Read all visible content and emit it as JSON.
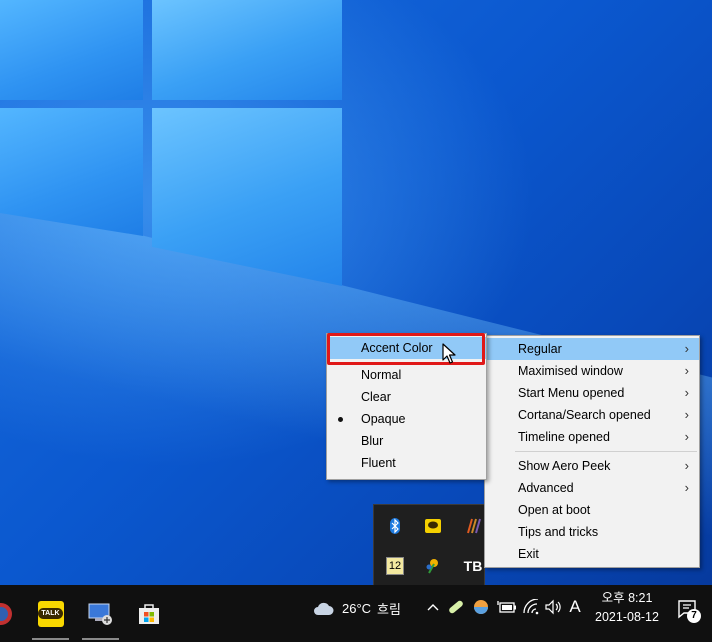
{
  "accent_menu": {
    "header": "Accent Color",
    "items": [
      "Normal",
      "Clear",
      "Opaque",
      "Blur",
      "Fluent"
    ],
    "selected": "Opaque"
  },
  "main_menu": {
    "items": [
      "Regular",
      "Maximised window",
      "Start Menu opened",
      "Cortana/Search opened",
      "Timeline opened"
    ],
    "items2": [
      "Show Aero Peek",
      "Advanced",
      "Open at boot",
      "Tips and tricks",
      "Exit"
    ]
  },
  "flyout": {
    "number_icon": "12",
    "tb_icon": "TB"
  },
  "taskbar": {
    "kakao_label": "TALK",
    "weather_temp": "26°C",
    "weather_cond": "흐림",
    "ime": "A",
    "time": "오후 8:21",
    "date": "2021-08-12",
    "notif_count": "7"
  },
  "colors": {
    "highlight": "#91c9f7",
    "annotation": "#e01818",
    "taskbar": "#101010"
  }
}
